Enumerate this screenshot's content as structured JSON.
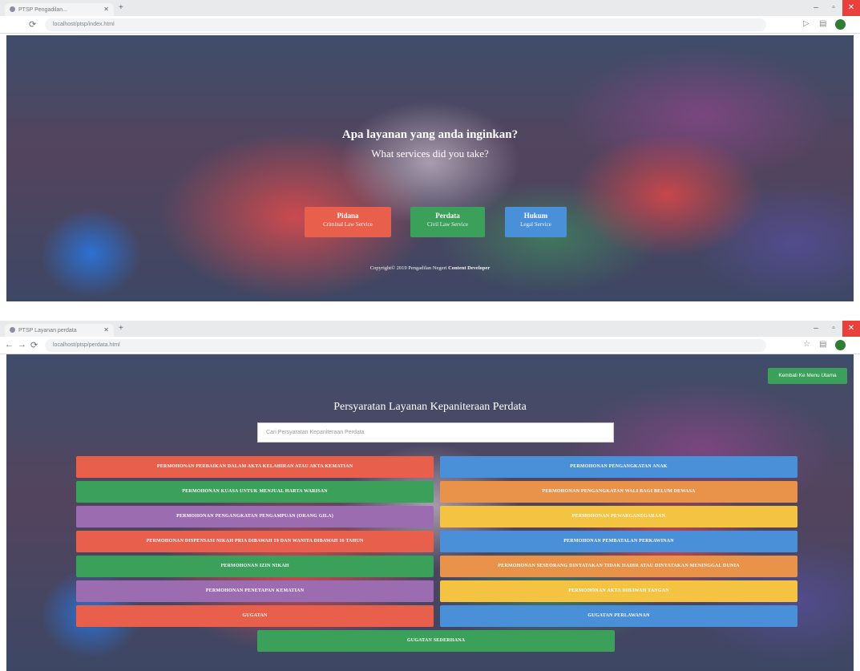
{
  "colors": {
    "red": "#e8604c",
    "green": "#3aa05a",
    "blue": "#4a90d9",
    "orange": "#e8924a",
    "purple": "#9b6cb0",
    "yellow": "#f3c341"
  },
  "browser1": {
    "tab_title": "PTSP Pengadilan...",
    "url": "localhost/ptsp/index.html",
    "new_tab": "+"
  },
  "hero": {
    "title": "Apa layanan yang anda inginkan?",
    "subtitle": "What services did you take?",
    "services": [
      {
        "title": "Pidana",
        "subtitle": "Criminal Law Service",
        "color": "#e8604c"
      },
      {
        "title": "Perdata",
        "subtitle": "Civil Law Service",
        "color": "#3aa05a"
      },
      {
        "title": "Hukum",
        "subtitle": "Legal Service",
        "color": "#4a90d9"
      }
    ],
    "copyright": "Copyright© 2019 Pengadilan Negeri",
    "copyright_strong": "Content Developer"
  },
  "browser2": {
    "tab_title": "PTSP Layanan perdata",
    "url": "localhost/ptsp/perdata.html",
    "new_tab": "+"
  },
  "perdata": {
    "back_button": "Kembali Ke Menu Utama",
    "title": "Persyaratan Layanan Kepaniteraan Perdata",
    "search_placeholder": "Cari Persyaratan Kepaniteraan Perdata",
    "buttons": [
      {
        "label": "Permohonan Perbaikan Dalam Akta Kelahiran Atau Akta Kematian",
        "color": "#e8604c"
      },
      {
        "label": "Permohonan Pengangkatan Anak",
        "color": "#4a90d9"
      },
      {
        "label": "Permohonan Kuasa Untuk Menjual Harta Warisan",
        "color": "#3aa05a"
      },
      {
        "label": "Permohonan Pengangkatan Wali Bagi Belum Dewasa",
        "color": "#e8924a"
      },
      {
        "label": "Permohonan Pengangkatan Pengampuan (Orang Gila)",
        "color": "#9b6cb0"
      },
      {
        "label": "Permohonan Pewarganegaraan",
        "color": "#f3c341"
      },
      {
        "label": "Permohonan Dispensasi Nikah Pria Dibawah 19 Dan Wanita Dibawah 16 Tahun",
        "color": "#e8604c"
      },
      {
        "label": "Permohonan Pembatalan Perkawinan",
        "color": "#4a90d9"
      },
      {
        "label": "Permohonan Izin Nikah",
        "color": "#3aa05a"
      },
      {
        "label": "Permohonan Seseorang Dinyatakan Tidak Hadir Atau Dinyatakan Meninggal Dunia",
        "color": "#e8924a"
      },
      {
        "label": "Permohonan Penetapan Kematian",
        "color": "#9b6cb0"
      },
      {
        "label": "Permohonan Akta Dibawah Tangan",
        "color": "#f3c341"
      },
      {
        "label": "Gugatan",
        "color": "#e8604c"
      },
      {
        "label": "Gugatan Perlawanan",
        "color": "#4a90d9"
      },
      {
        "label": "Gugatan Sederhana",
        "color": "#3aa05a"
      }
    ]
  }
}
